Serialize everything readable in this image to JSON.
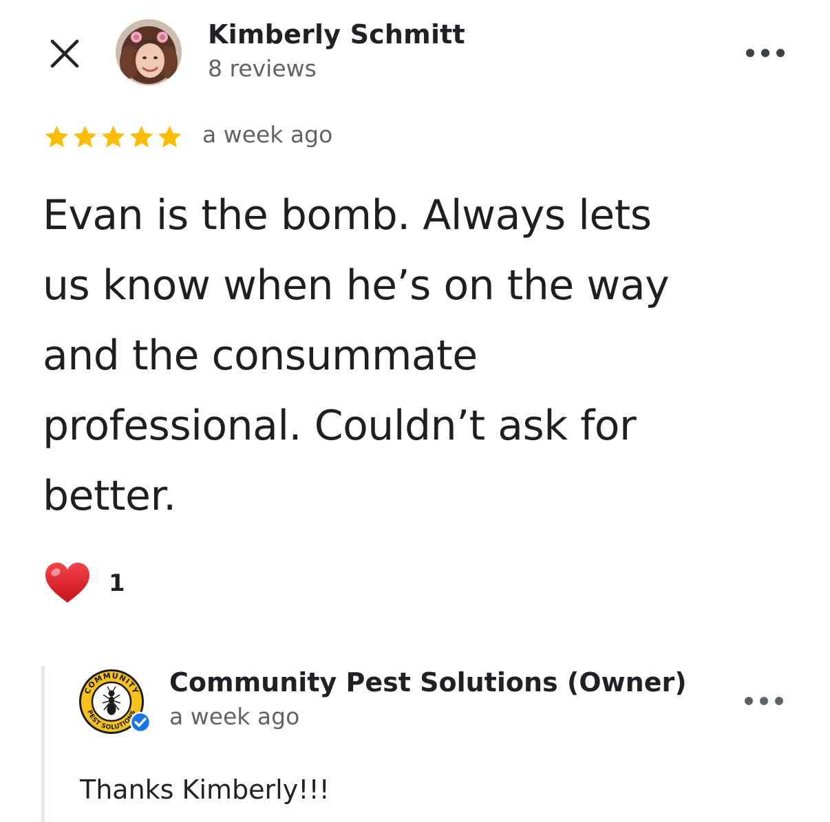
{
  "review": {
    "author": {
      "name": "Kimberly Schmitt",
      "meta": "8 reviews",
      "avatar_icon": "avatar-photo"
    },
    "rating": 5,
    "rating_max": 5,
    "star_color": "#fbbc04",
    "date": "a week ago",
    "text": "Evan is the bomb.  Always lets\nus know when he’s on the way\nand the consummate\nprofessional.  Couldn’t ask for\nbetter.",
    "reactions": [
      {
        "icon": "heart-icon",
        "count": "1",
        "color": "#e0242e"
      }
    ]
  },
  "owner_reply": {
    "name": "Community Pest Solutions (Owner)",
    "date": "a week ago",
    "text": "Thanks Kimberly!!!",
    "logo": {
      "top_text": "COMMUNITY",
      "bottom_text": "PEST SOLUTIONS",
      "ring_color": "#f5c21b",
      "verified_color": "#1a73e8"
    }
  },
  "icons": {
    "close": "close-icon",
    "more": "more-options-icon",
    "verified": "verified-check-icon"
  }
}
